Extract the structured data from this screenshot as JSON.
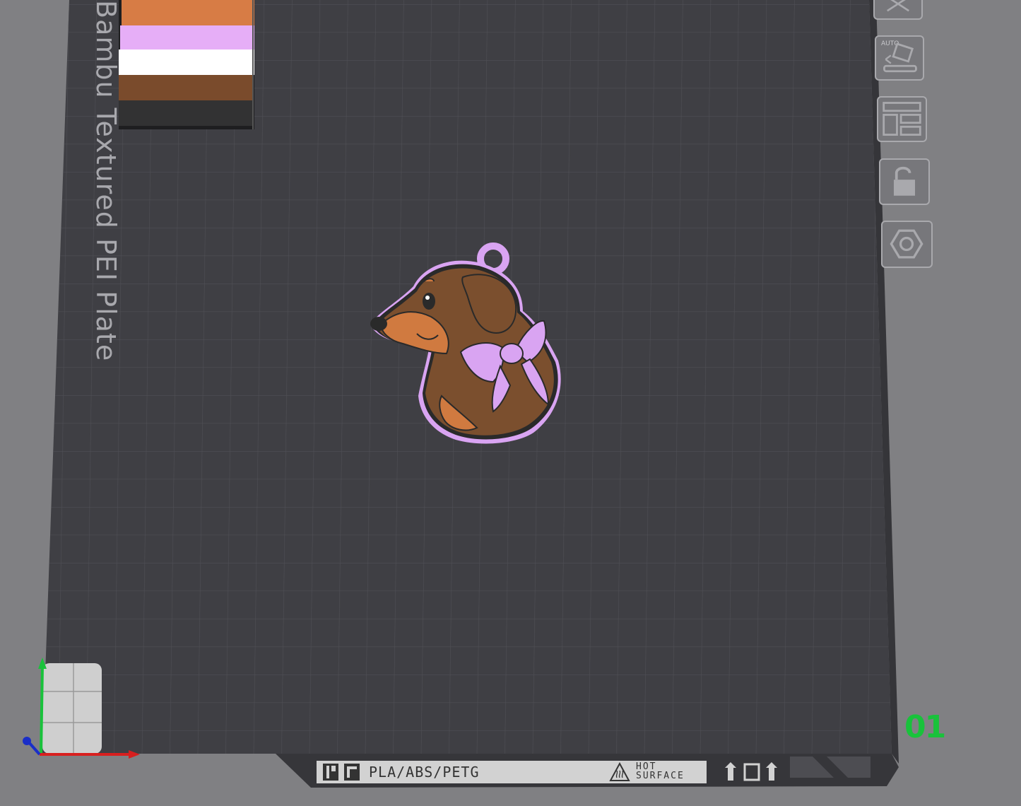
{
  "plate": {
    "label": "Bambu Textured PEI Plate",
    "number": "01",
    "material_label": "PLA/ABS/PETG",
    "warning_line1": "HOT",
    "warning_line2": "SURFACE"
  },
  "toolbar": {
    "items": [
      {
        "name": "close-icon",
        "label": ""
      },
      {
        "name": "auto-orient-icon",
        "label": "AUTO"
      },
      {
        "name": "arrange-icon",
        "label": ""
      },
      {
        "name": "lock-icon",
        "label": ""
      },
      {
        "name": "plate-settings-icon",
        "label": ""
      }
    ]
  },
  "filament_swatches": [
    "#d77c45",
    "#e6aef7",
    "#ffffff",
    "#7a4b2c",
    "#323233"
  ],
  "colors": {
    "plate": "#3f3f44",
    "background": "#808083",
    "number": "#19c23b",
    "model_body": "#7b4f2e",
    "model_accent": "#d07a40",
    "model_bow": "#d9a4f2"
  },
  "axes": [
    "x-axis",
    "y-axis",
    "z-axis"
  ]
}
